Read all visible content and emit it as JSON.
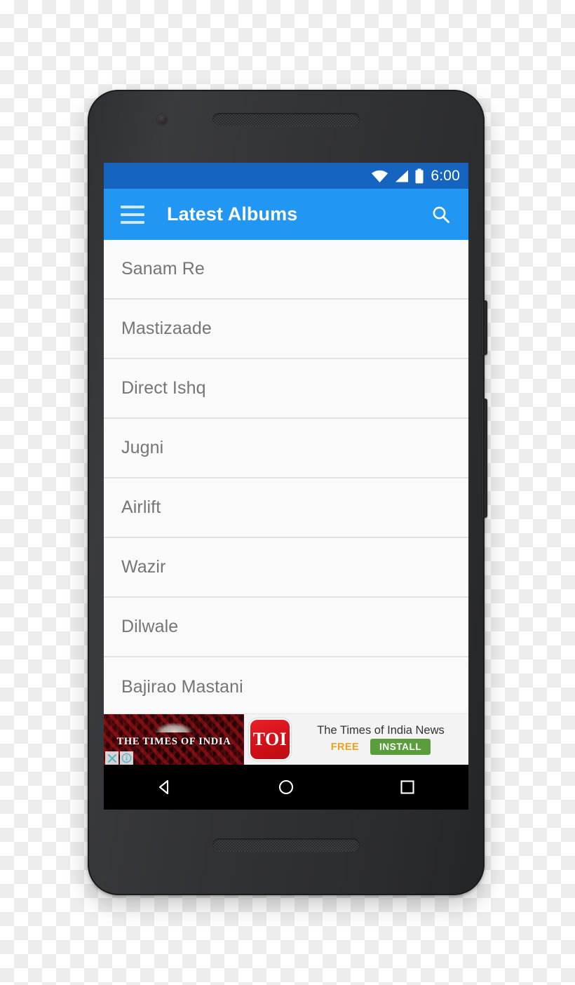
{
  "device": {
    "hardware": {
      "front_camera": "front-camera",
      "earpiece": "earpiece-speaker",
      "bottom_speaker": "bottom-speaker",
      "power_button": "power-button",
      "volume_button": "volume-rocker"
    }
  },
  "status_bar": {
    "clock": "6:00",
    "icons": [
      "wifi-icon",
      "signal-icon",
      "battery-icon"
    ],
    "background_color": "#1565c0"
  },
  "app_bar": {
    "menu_icon": "hamburger-menu-icon",
    "title": "Latest Albums",
    "search_icon": "search-icon",
    "background_color": "#2196f3",
    "title_color": "#ffffff"
  },
  "album_list": {
    "items": [
      {
        "label": "Sanam Re"
      },
      {
        "label": "Mastizaade"
      },
      {
        "label": "Direct Ishq"
      },
      {
        "label": "Jugni"
      },
      {
        "label": "Airlift"
      },
      {
        "label": "Wazir"
      },
      {
        "label": "Dilwale"
      },
      {
        "label": "Bajirao Mastani"
      }
    ],
    "text_color": "#757575",
    "background_color": "#fafafa",
    "divider_color": "#e2e2e2"
  },
  "ad_banner": {
    "artwork_title": "THE TIMES OF INDIA",
    "logo_text": "TOI",
    "headline": "The Times of India News",
    "price_label": "FREE",
    "install_label": "INSTALL",
    "close_icon": "close-icon",
    "info_icon": "info-icon",
    "logo_color": "#d21017",
    "install_color": "#5b9c3d",
    "price_color": "#f0a020"
  },
  "nav_bar": {
    "back_icon": "back-triangle-icon",
    "home_icon": "home-circle-icon",
    "recents_icon": "recents-square-icon",
    "background_color": "#000000"
  }
}
